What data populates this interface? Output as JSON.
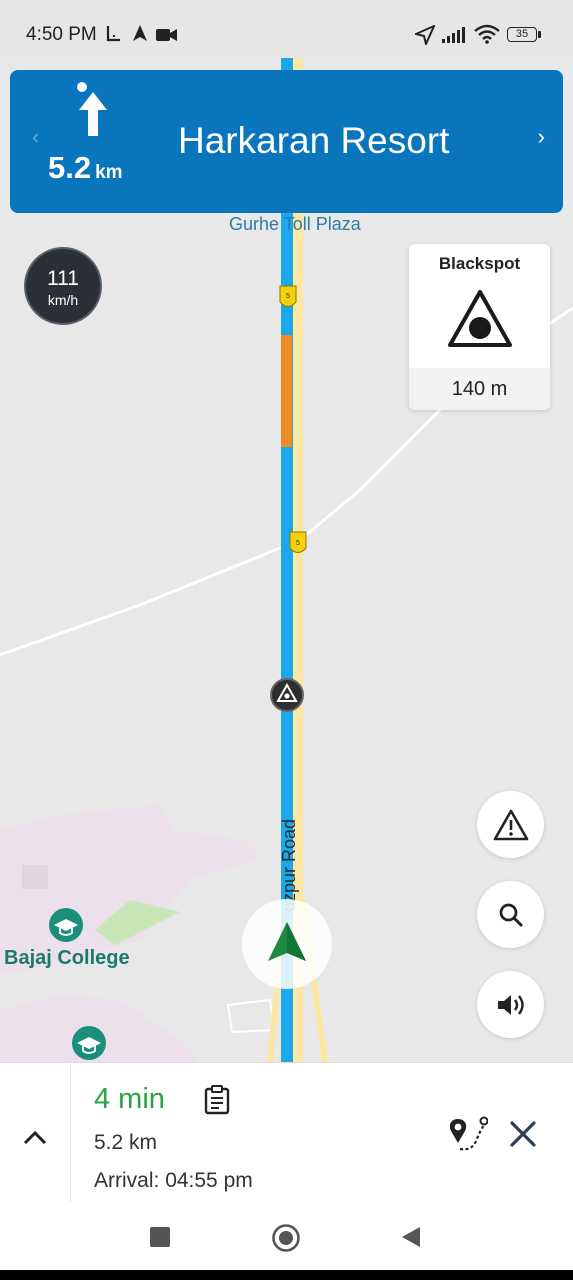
{
  "status_bar": {
    "time": "4:50 PM",
    "battery": "35",
    "icons": [
      "usb-debug-icon",
      "navigation-arrow-icon",
      "video-camera-icon",
      "location-arrow-icon",
      "cell-signal-icon",
      "wifi-icon",
      "battery-icon"
    ]
  },
  "navigation": {
    "distance_value": "5.2",
    "distance_unit": "km",
    "destination": "Harkaran Resort",
    "maneuver_icon": "straight-arrow-icon",
    "prev_icon": "chevron-left-icon",
    "next_icon": "chevron-right-icon"
  },
  "map": {
    "toll_label": "Gurhe Toll Plaza",
    "road_label": "Jodhpur Road",
    "road_label_visible": "ozpur Road",
    "poi_label": "Bajaj College",
    "highway_shield": "NH 5"
  },
  "speed": {
    "value": "111",
    "unit": "km/h"
  },
  "blackspot": {
    "title": "Blackspot",
    "distance": "140 m",
    "icon": "warning-triangle-icon"
  },
  "controls": {
    "report_icon": "alert-icon",
    "search_icon": "search-icon",
    "volume_icon": "volume-icon"
  },
  "trip": {
    "duration": "4 min",
    "distance": "5.2 km",
    "arrival_label": "Arrival:",
    "arrival_time": "04:55 pm"
  },
  "colors": {
    "banner": "#0875bd",
    "route": "#1aa7ec",
    "road": "#fbe7a1",
    "eta_green": "#2aa344",
    "traffic_orange": "#f08a24"
  }
}
